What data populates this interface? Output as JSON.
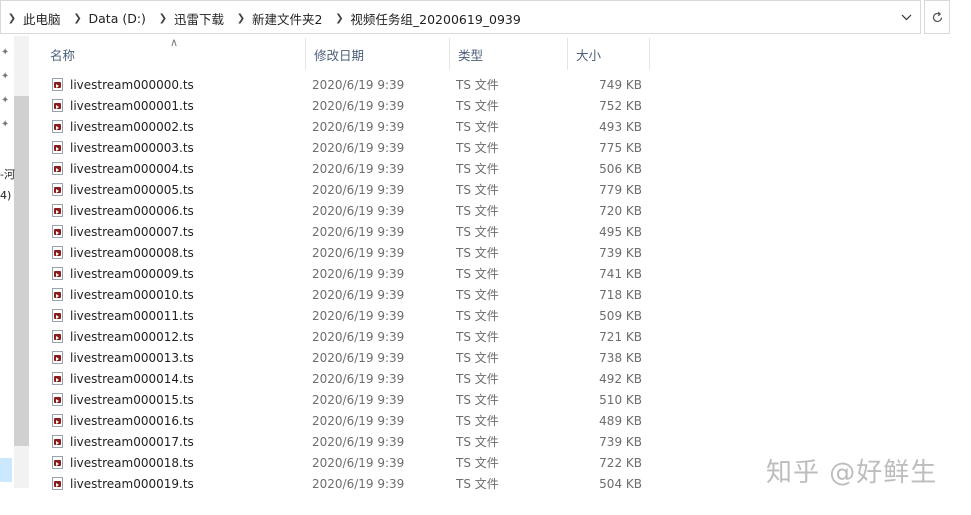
{
  "address": {
    "crumbs": [
      "此电脑",
      "Data (D:)",
      "迅雷下载",
      "新建文件夹2",
      "视频任务组_20200619_0939"
    ]
  },
  "nav": {
    "fragments": [
      "-河",
      "4)"
    ]
  },
  "columns": {
    "name": "名称",
    "date": "修改日期",
    "type": "类型",
    "size": "大小"
  },
  "files": [
    {
      "name": "livestream000000.ts",
      "date": "2020/6/19 9:39",
      "type": "TS 文件",
      "size": "749 KB"
    },
    {
      "name": "livestream000001.ts",
      "date": "2020/6/19 9:39",
      "type": "TS 文件",
      "size": "752 KB"
    },
    {
      "name": "livestream000002.ts",
      "date": "2020/6/19 9:39",
      "type": "TS 文件",
      "size": "493 KB"
    },
    {
      "name": "livestream000003.ts",
      "date": "2020/6/19 9:39",
      "type": "TS 文件",
      "size": "775 KB"
    },
    {
      "name": "livestream000004.ts",
      "date": "2020/6/19 9:39",
      "type": "TS 文件",
      "size": "506 KB"
    },
    {
      "name": "livestream000005.ts",
      "date": "2020/6/19 9:39",
      "type": "TS 文件",
      "size": "779 KB"
    },
    {
      "name": "livestream000006.ts",
      "date": "2020/6/19 9:39",
      "type": "TS 文件",
      "size": "720 KB"
    },
    {
      "name": "livestream000007.ts",
      "date": "2020/6/19 9:39",
      "type": "TS 文件",
      "size": "495 KB"
    },
    {
      "name": "livestream000008.ts",
      "date": "2020/6/19 9:39",
      "type": "TS 文件",
      "size": "739 KB"
    },
    {
      "name": "livestream000009.ts",
      "date": "2020/6/19 9:39",
      "type": "TS 文件",
      "size": "741 KB"
    },
    {
      "name": "livestream000010.ts",
      "date": "2020/6/19 9:39",
      "type": "TS 文件",
      "size": "718 KB"
    },
    {
      "name": "livestream000011.ts",
      "date": "2020/6/19 9:39",
      "type": "TS 文件",
      "size": "509 KB"
    },
    {
      "name": "livestream000012.ts",
      "date": "2020/6/19 9:39",
      "type": "TS 文件",
      "size": "721 KB"
    },
    {
      "name": "livestream000013.ts",
      "date": "2020/6/19 9:39",
      "type": "TS 文件",
      "size": "738 KB"
    },
    {
      "name": "livestream000014.ts",
      "date": "2020/6/19 9:39",
      "type": "TS 文件",
      "size": "492 KB"
    },
    {
      "name": "livestream000015.ts",
      "date": "2020/6/19 9:39",
      "type": "TS 文件",
      "size": "510 KB"
    },
    {
      "name": "livestream000016.ts",
      "date": "2020/6/19 9:39",
      "type": "TS 文件",
      "size": "489 KB"
    },
    {
      "name": "livestream000017.ts",
      "date": "2020/6/19 9:39",
      "type": "TS 文件",
      "size": "739 KB"
    },
    {
      "name": "livestream000018.ts",
      "date": "2020/6/19 9:39",
      "type": "TS 文件",
      "size": "722 KB"
    },
    {
      "name": "livestream000019.ts",
      "date": "2020/6/19 9:39",
      "type": "TS 文件",
      "size": "504 KB"
    }
  ],
  "watermark": "知乎 @好鲜生",
  "icons": {
    "crumb_separator": "chevron-right-icon",
    "dropdown": "chevron-down-icon",
    "refresh": "refresh-icon",
    "pin": "pin-icon",
    "file": "ts-video-file-icon"
  }
}
